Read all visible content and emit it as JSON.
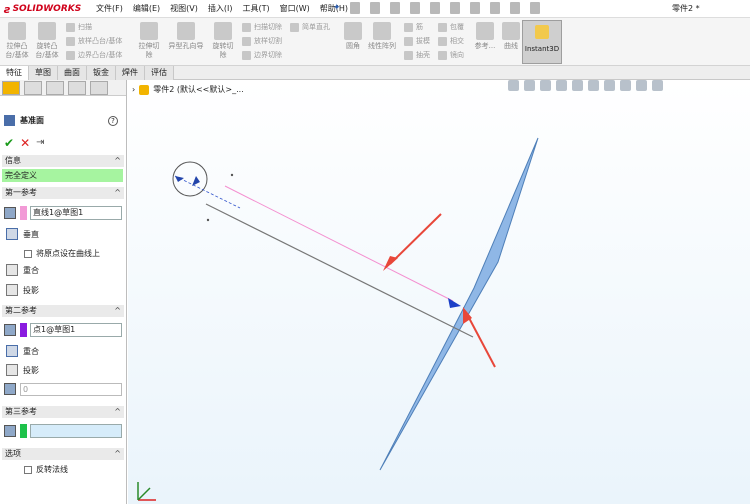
{
  "app": {
    "logo_text": "SOLIDWORKS",
    "document_title": "零件2 *"
  },
  "menu": [
    "文件(F)",
    "编辑(E)",
    "视图(V)",
    "插入(I)",
    "工具(T)",
    "窗口(W)",
    "帮助(H)"
  ],
  "ribbon": {
    "extrude_boss": "拉伸凸台/基体",
    "revolve_boss": "旋转凸台/基体",
    "sweep": "扫描",
    "loft_boss": "放样凸台/基体",
    "boundary_boss": "边界凸台/基体",
    "extrude_cut": "拉伸切除",
    "hole_wizard": "异型孔向导",
    "revolve_cut": "旋转切除",
    "swept_cut": "扫描切除",
    "lofted_cut": "放样切割",
    "boundary_cut": "边界切除",
    "simple_hole": "简单直孔",
    "fillet": "圆角",
    "linear_pattern": "线性阵列",
    "rib": "筋",
    "draft": "拔模",
    "shell": "抽壳",
    "wrap": "包覆",
    "intersect": "相交",
    "mirror": "镜向",
    "reference": "参考...",
    "curves": "曲线",
    "instant3d": "Instant3D"
  },
  "tabs": [
    "特征",
    "草图",
    "曲面",
    "钣金",
    "焊件",
    "评估"
  ],
  "panel": {
    "title": "基准面",
    "help": "?",
    "info_header": "信息",
    "status": "完全定义",
    "first_ref": {
      "header": "第一参考",
      "value": "直线1@草图1",
      "color": "#f29ad6",
      "options": [
        "垂直",
        "将原点设在曲线上",
        "重合",
        "投影"
      ]
    },
    "second_ref": {
      "header": "第二参考",
      "value": "点1@草图1",
      "color": "#8a1be0",
      "options": [
        "重合",
        "投影"
      ],
      "number": "0"
    },
    "third_ref": {
      "header": "第三参考",
      "value": "",
      "color": "#1ec24a"
    },
    "options_header": "选项",
    "flip_normal": "反转法线"
  },
  "viewport": {
    "tree_label": "零件2 (默认<<默认>_..."
  },
  "colors": {
    "plane_fill": "#8fb7e6",
    "arrow": "#e8473a",
    "sketch_line": "#f48fd0",
    "accent": "#d0021b"
  }
}
